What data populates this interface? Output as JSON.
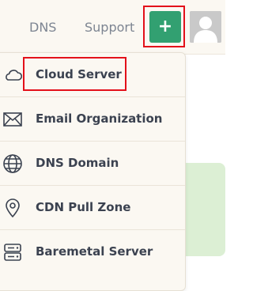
{
  "topbar": {
    "nav_dns": "DNS",
    "nav_support": "Support",
    "add_symbol": "+"
  },
  "menu": {
    "items": [
      {
        "label": "Cloud Server",
        "icon": "cloud-icon"
      },
      {
        "label": "Email Organization",
        "icon": "mail-icon"
      },
      {
        "label": "DNS Domain",
        "icon": "globe-icon"
      },
      {
        "label": "CDN Pull Zone",
        "icon": "location-pin-icon"
      },
      {
        "label": "Baremetal Server",
        "icon": "server-icon"
      }
    ]
  },
  "colors": {
    "accent_green": "#32a071",
    "highlight_red": "#e3101a",
    "card_green": "#dcefd4"
  }
}
